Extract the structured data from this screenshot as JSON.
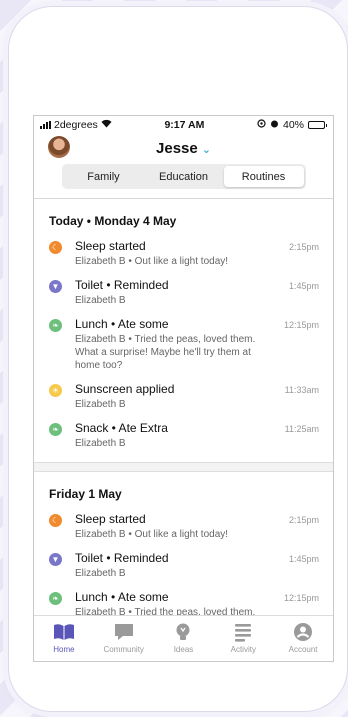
{
  "status": {
    "carrier": "2degrees",
    "time": "9:17 AM",
    "battery": "40%",
    "battery_fraction": 0.4
  },
  "header": {
    "title": "Jesse"
  },
  "segments": [
    {
      "label": "Family",
      "active": false
    },
    {
      "label": "Education",
      "active": false
    },
    {
      "label": "Routines",
      "active": true
    }
  ],
  "days": [
    {
      "label": "Today • Monday 4 May",
      "entries": [
        {
          "type": "sleep",
          "icon": "moon-icon",
          "title": "Sleep started",
          "detail": "Elizabeth B • Out like a light today!",
          "time": "2:15pm"
        },
        {
          "type": "toilet",
          "icon": "toilet-icon",
          "title": "Toilet • Reminded",
          "detail": "Elizabeth B",
          "time": "1:45pm"
        },
        {
          "type": "food",
          "icon": "leaf-icon",
          "title": "Lunch • Ate some",
          "detail": "Elizabeth B • Tried the peas, loved them. What a surprise! Maybe he'll try them at home too?",
          "time": "12:15pm"
        },
        {
          "type": "sun",
          "icon": "sun-icon",
          "title": "Sunscreen applied",
          "detail": "Elizabeth B",
          "time": "11:33am"
        },
        {
          "type": "food",
          "icon": "leaf-icon",
          "title": "Snack • Ate Extra",
          "detail": "Elizabeth B",
          "time": "11:25am"
        }
      ]
    },
    {
      "label": "Friday 1 May",
      "entries": [
        {
          "type": "sleep",
          "icon": "moon-icon",
          "title": "Sleep started",
          "detail": "Elizabeth B • Out like a light today!",
          "time": "2:15pm"
        },
        {
          "type": "toilet",
          "icon": "toilet-icon",
          "title": "Toilet • Reminded",
          "detail": "Elizabeth B",
          "time": "1:45pm"
        },
        {
          "type": "food",
          "icon": "leaf-icon",
          "title": "Lunch • Ate some",
          "detail": "Elizabeth B • Tried the peas, loved them.",
          "time": "12:15pm"
        }
      ]
    }
  ],
  "tabs": [
    {
      "label": "Home",
      "icon": "book-icon",
      "active": true
    },
    {
      "label": "Community",
      "icon": "chat-icon",
      "active": false
    },
    {
      "label": "Ideas",
      "icon": "lightbulb-icon",
      "active": false
    },
    {
      "label": "Activity",
      "icon": "list-icon",
      "active": false
    },
    {
      "label": "Account",
      "icon": "person-icon",
      "active": false
    }
  ],
  "colors": {
    "accent": "#5a56b8",
    "inactive": "#9a9a9a",
    "sleep": "#f08a2c",
    "toilet": "#7a76c9",
    "food": "#6cc07c",
    "sun": "#f7c94a",
    "chevron": "#3fa9c9"
  }
}
